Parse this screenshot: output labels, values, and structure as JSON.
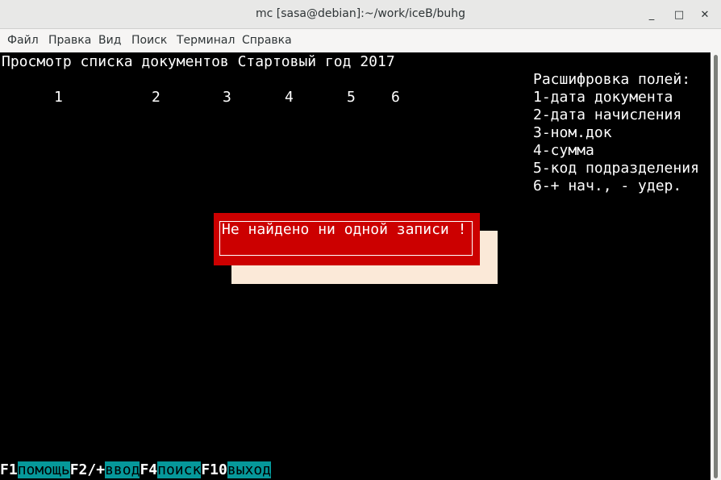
{
  "window": {
    "title": "mc [sasa@debian]:~/work/iceB/buhg",
    "minimize_glyph": "_",
    "maximize_glyph": "□",
    "close_glyph": "✕"
  },
  "menu": [
    "Файл",
    "Правка",
    "Вид",
    "Поиск",
    "Терминал",
    "Справка"
  ],
  "screen": {
    "header": "Просмотр списка документов Стартовый год 2017",
    "column_numbers": [
      "1",
      "2",
      "3",
      "4",
      "5",
      "6"
    ],
    "legend": {
      "title": "Расшифровка полей:",
      "items": [
        "1-дата документа",
        "2-дата начисления",
        "3-ном.док",
        "4-сумма",
        "5-код подразделения",
        "6-+ нач., - удер."
      ]
    },
    "dialog_message": "Не найдено ни одной записи !"
  },
  "function_keys": [
    {
      "key": "F1",
      "label": "помощь"
    },
    {
      "key": "F2/+",
      "label": "ввод"
    },
    {
      "key": "F4",
      "label": "поиск"
    },
    {
      "key": "F10",
      "label": "выход"
    }
  ],
  "colors": {
    "terminal_bg": "#000000",
    "terminal_fg": "#ffffff",
    "dialog_bg": "#cc0000",
    "dialog_shadow": "#fbe9d8",
    "fkey_label_bg": "#06989a"
  }
}
